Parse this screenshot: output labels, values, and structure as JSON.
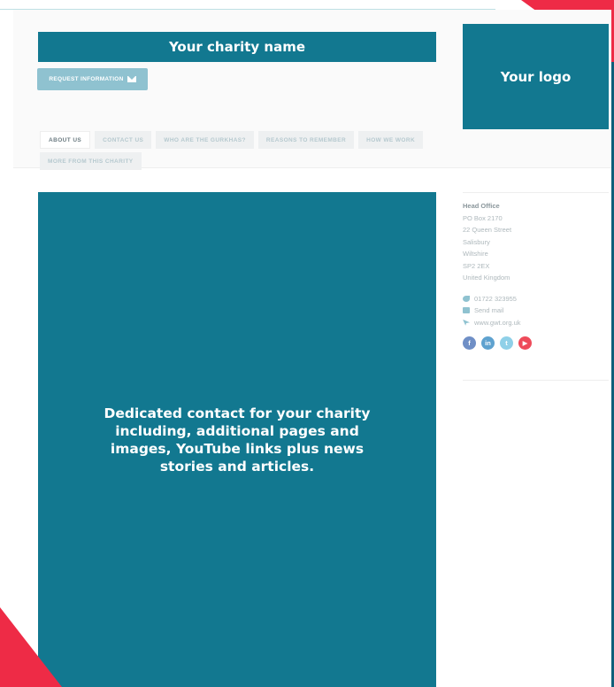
{
  "header": {
    "charity_name": "Your charity name",
    "request_button": "REQUEST INFORMATION",
    "logo_text": "Your logo"
  },
  "tabs": [
    {
      "label": "ABOUT US",
      "active": true
    },
    {
      "label": "CONTACT US",
      "active": false
    },
    {
      "label": "WHO ARE THE GURKHAS?",
      "active": false
    },
    {
      "label": "REASONS TO REMEMBER",
      "active": false
    },
    {
      "label": "HOW WE WORK",
      "active": false
    },
    {
      "label": "MORE FROM THIS CHARITY",
      "active": false
    }
  ],
  "main": {
    "text": "Dedicated contact for your charity including, additional pages and images, YouTube links plus news stories and articles."
  },
  "contact": {
    "title": "Head Office",
    "address": [
      "PO Box 2170",
      "22 Queen Street",
      "Salisbury",
      "Wiltshire",
      "SP2 2EX",
      "United Kingdom"
    ],
    "phone": "01722 323955",
    "email_label": "Send mail",
    "website": "www.gwt.org.uk",
    "social": [
      "f",
      "in",
      "t",
      "▶"
    ]
  },
  "colors": {
    "brand_teal": "#127890",
    "button_light": "#8fc2d0",
    "accent_red": "#ee2b46"
  }
}
